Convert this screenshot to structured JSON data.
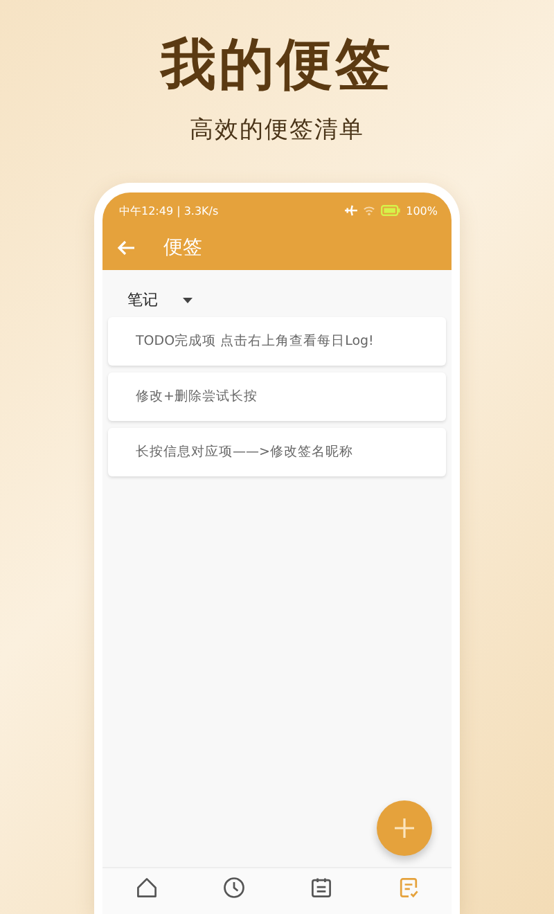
{
  "hero": {
    "title": "我的便签",
    "subtitle": "高效的便签清单"
  },
  "status_bar": {
    "time": "中午12:49 | 3.3K/s",
    "battery": "100%"
  },
  "toolbar": {
    "title": "便签"
  },
  "category_dropdown": {
    "value": "笔记"
  },
  "notes": [
    {
      "text": "TODO完成项 点击右上角查看每日Log!"
    },
    {
      "text": "修改+删除尝试长按"
    },
    {
      "text": "长按信息对应项——>修改签名昵称"
    }
  ],
  "bottom_nav": [
    {
      "kind": "home",
      "selected": false
    },
    {
      "kind": "clock",
      "selected": false
    },
    {
      "kind": "calendar",
      "selected": false
    },
    {
      "kind": "note",
      "selected": true
    }
  ]
}
